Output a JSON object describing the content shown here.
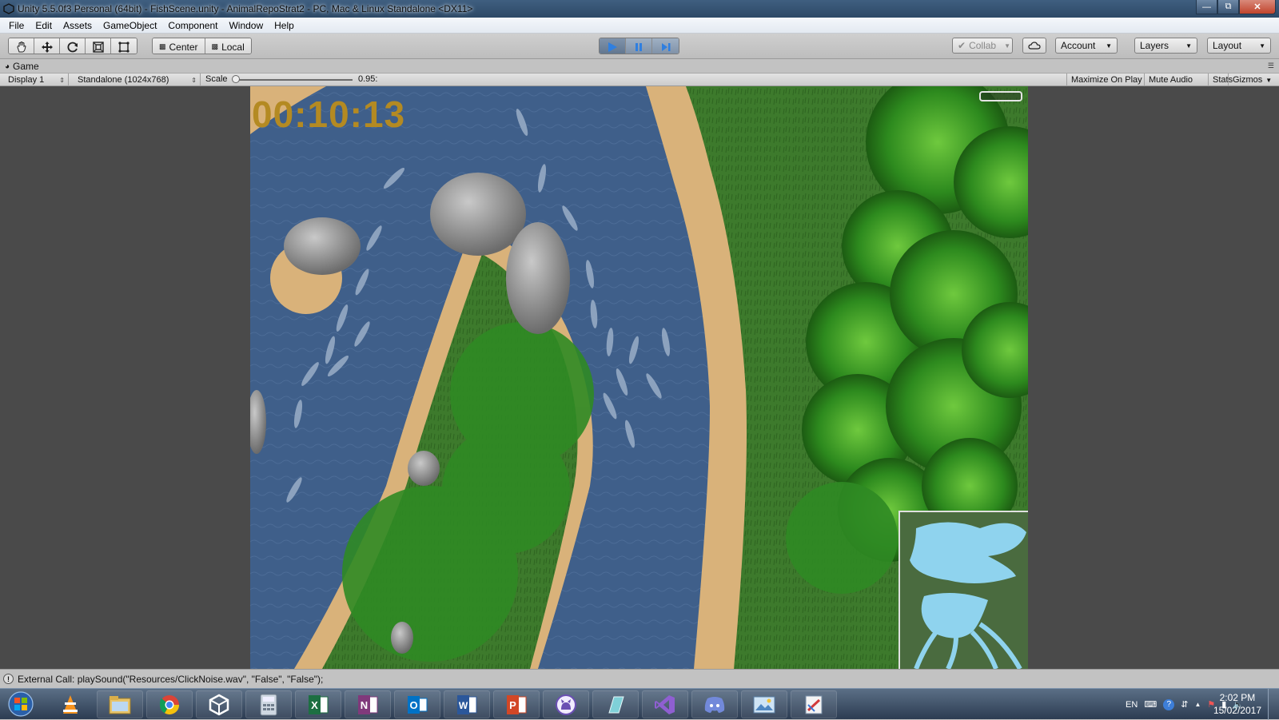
{
  "window": {
    "title": "Unity 5.5.0f3 Personal (64bit) - FishScene.unity - AnimalRepoStrat2 - PC, Mac & Linux Standalone <DX11>"
  },
  "menu": [
    "File",
    "Edit",
    "Assets",
    "GameObject",
    "Component",
    "Window",
    "Help"
  ],
  "toolbar": {
    "pivot_center": "Center",
    "pivot_local": "Local",
    "collab": "Collab",
    "account": "Account",
    "layers": "Layers",
    "layout": "Layout"
  },
  "game_tab": {
    "label": "Game"
  },
  "game_bar": {
    "display": "Display 1",
    "resolution": "Standalone (1024x768)",
    "scale_label": "Scale",
    "scale_value": "0.95:",
    "maximize": "Maximize On Play",
    "mute": "Mute Audio",
    "stats": "Stats",
    "gizmos": "Gizmos"
  },
  "game": {
    "timer": "00:10:13"
  },
  "status": {
    "message": "External Call: playSound(\"Resources/ClickNoise.wav\", \"False\", \"False\");"
  },
  "taskbar": {
    "apps": [
      "vlc-icon",
      "file-explorer-icon",
      "chrome-icon",
      "unity-icon",
      "calculator-icon",
      "excel-icon",
      "onenote-icon",
      "outlook-icon",
      "word-icon",
      "powerpoint-icon",
      "github-icon",
      "app-icon",
      "visual-studio-icon",
      "discord-icon",
      "photos-icon",
      "paint-icon"
    ],
    "language": "EN",
    "time": "2:02 PM",
    "date": "15/02/2017"
  },
  "colors": {
    "timer": "#b48a22",
    "play_accent": "#2f7fe0",
    "unity_bg": "#c2c2c2"
  }
}
